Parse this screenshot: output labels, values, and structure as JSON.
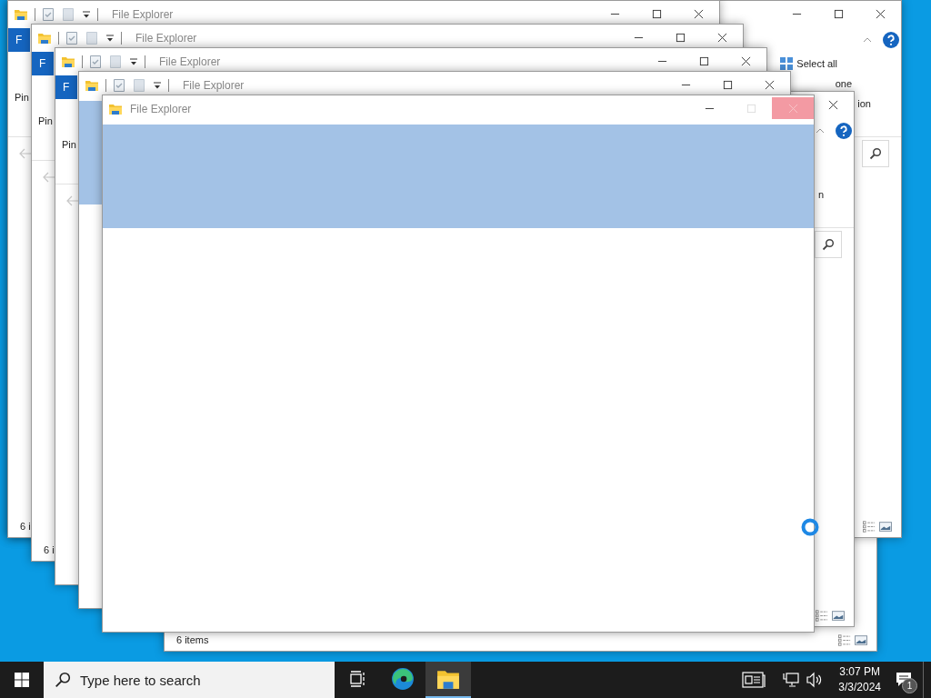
{
  "windows": [
    {
      "kind": "explorer",
      "status": "6 items"
    },
    {
      "kind": "explorer",
      "ribbon_items": [
        {
          "kind": "select_all",
          "label": "Select all"
        },
        {
          "kind": "text",
          "label": "one"
        },
        {
          "kind": "text",
          "label": "ion"
        }
      ]
    },
    {
      "kind": "explorer",
      "ribbon_items": [
        {
          "kind": "text",
          "label": "n"
        }
      ]
    },
    {
      "kind": "explorer",
      "title": "File Explorer",
      "ribbon_tab": "F",
      "ribbon_label": "Pin",
      "status": "6 i"
    },
    {
      "kind": "explorer",
      "title": "File Explorer",
      "ribbon_tab": "F",
      "ribbon_label": "Pin",
      "status": "6 i"
    },
    {
      "kind": "explorer",
      "title": "File Explorer",
      "ribbon_tab": "F",
      "ribbon_label": "Pin"
    },
    {
      "kind": "loading",
      "title": "File Explorer"
    },
    {
      "kind": "starting",
      "title": "File Explorer",
      "close_hover": true
    }
  ],
  "taskbar": {
    "search_placeholder": "Type here to search",
    "apps": [
      {
        "kind": "task_view",
        "selected": false
      },
      {
        "kind": "browser",
        "selected": false
      },
      {
        "kind": "files",
        "selected": true
      }
    ],
    "time": "3:07 PM",
    "date": "3/3/2024",
    "notification_count": "1"
  }
}
